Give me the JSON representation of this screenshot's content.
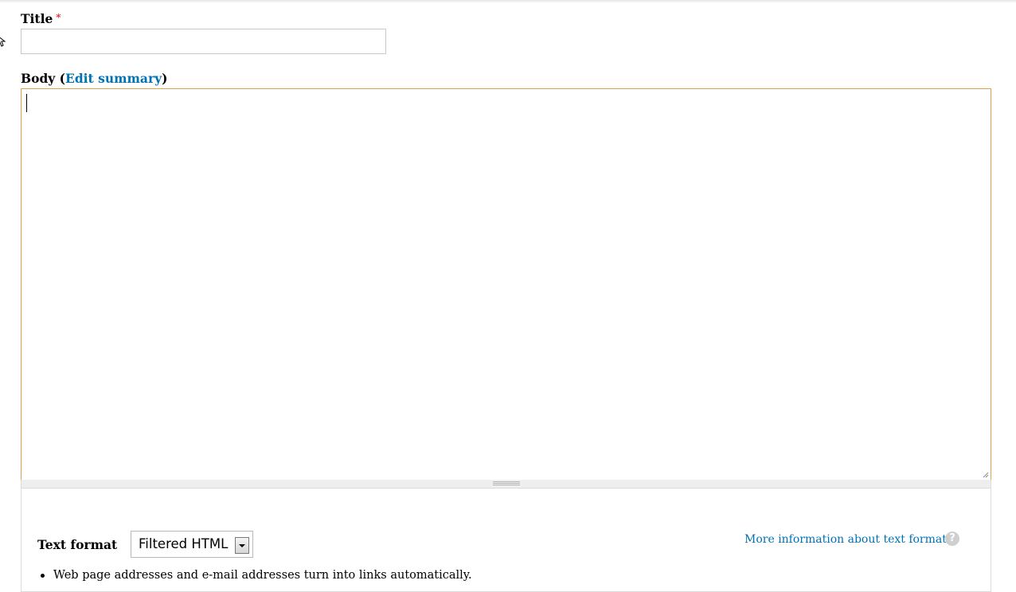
{
  "title_field": {
    "label": "Title",
    "required_marker": "*",
    "value": ""
  },
  "body_field": {
    "label_prefix": "Body (",
    "edit_summary_link": "Edit summary",
    "label_suffix": ")",
    "value": ""
  },
  "text_format": {
    "label": "Text format",
    "selected": "Filtered HTML",
    "more_info_link": "More information about text formats",
    "help_icon_glyph": "?",
    "tips": [
      "Web page addresses and e-mail addresses turn into links automatically."
    ]
  },
  "colors": {
    "link": "#0071b3",
    "focus_border": "#e2a04a",
    "required": "#ee0000"
  },
  "icons": {
    "help": "question-circle-icon",
    "select_arrow": "chevron-down-icon",
    "resize": "resize-grip-icon"
  }
}
